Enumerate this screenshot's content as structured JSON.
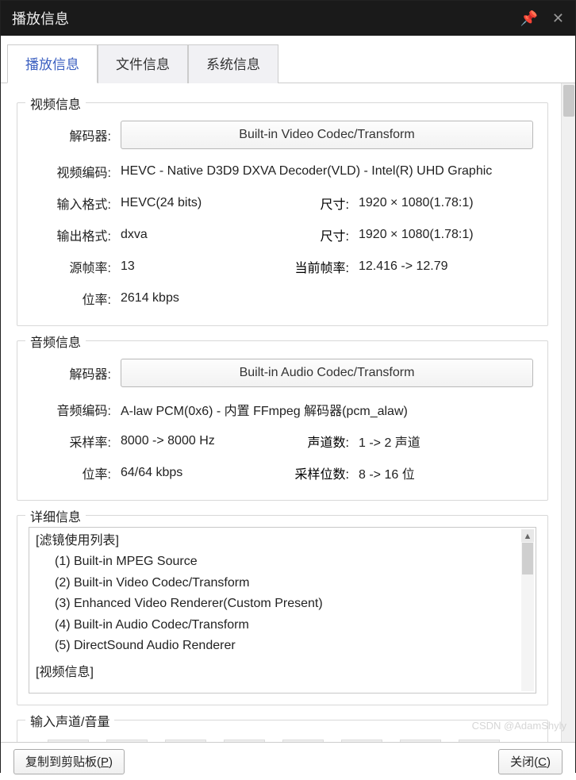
{
  "window": {
    "title": "播放信息"
  },
  "tabs": {
    "play": "播放信息",
    "file": "文件信息",
    "system": "系统信息"
  },
  "video": {
    "legend": "视频信息",
    "decoder_label": "解码器:",
    "decoder_button": "Built-in Video Codec/Transform",
    "codec_label": "视频编码:",
    "codec_value": "HEVC - Native D3D9 DXVA Decoder(VLD) - Intel(R) UHD Graphic",
    "input_fmt_label": "输入格式:",
    "input_fmt_value": "HEVC(24 bits)",
    "input_size_label": "尺寸:",
    "input_size_value": "1920 × 1080(1.78:1)",
    "output_fmt_label": "输出格式:",
    "output_fmt_value": "dxva",
    "output_size_label": "尺寸:",
    "output_size_value": "1920 × 1080(1.78:1)",
    "src_fps_label": "源帧率:",
    "src_fps_value": "13",
    "cur_fps_label": "当前帧率:",
    "cur_fps_value": "12.416 -> 12.79",
    "bitrate_label": "位率:",
    "bitrate_value": "2614 kbps"
  },
  "audio": {
    "legend": "音频信息",
    "decoder_label": "解码器:",
    "decoder_button": "Built-in Audio Codec/Transform",
    "codec_label": "音频编码:",
    "codec_value": "A-law PCM(0x6) - 内置 FFmpeg 解码器(pcm_alaw)",
    "sample_label": "采样率:",
    "sample_value": "8000 -> 8000 Hz",
    "channels_label": "声道数:",
    "channels_value": "1 -> 2 声道",
    "bitrate_label": "位率:",
    "bitrate_value": "64/64 kbps",
    "bits_label": "采样位数:",
    "bits_value": "8 -> 16 位"
  },
  "detail": {
    "legend": "详细信息",
    "header": "[滤镜使用列表]",
    "lines": [
      "(1) Built-in MPEG Source",
      "(2) Built-in Video Codec/Transform",
      "(3) Enhanced Video Renderer(Custom Present)",
      "(4) Built-in Audio Codec/Transform",
      "(5) DirectSound Audio Renderer"
    ],
    "truncated": "[视频信息]"
  },
  "volume": {
    "legend": "输入声道/音量"
  },
  "footer": {
    "copy_label": "复制到剪贴板(",
    "copy_hotkey": "P",
    "copy_label_end": ")",
    "close_label": "关闭(",
    "close_hotkey": "C",
    "close_label_end": ")"
  },
  "watermark": "CSDN @AdamShyly"
}
